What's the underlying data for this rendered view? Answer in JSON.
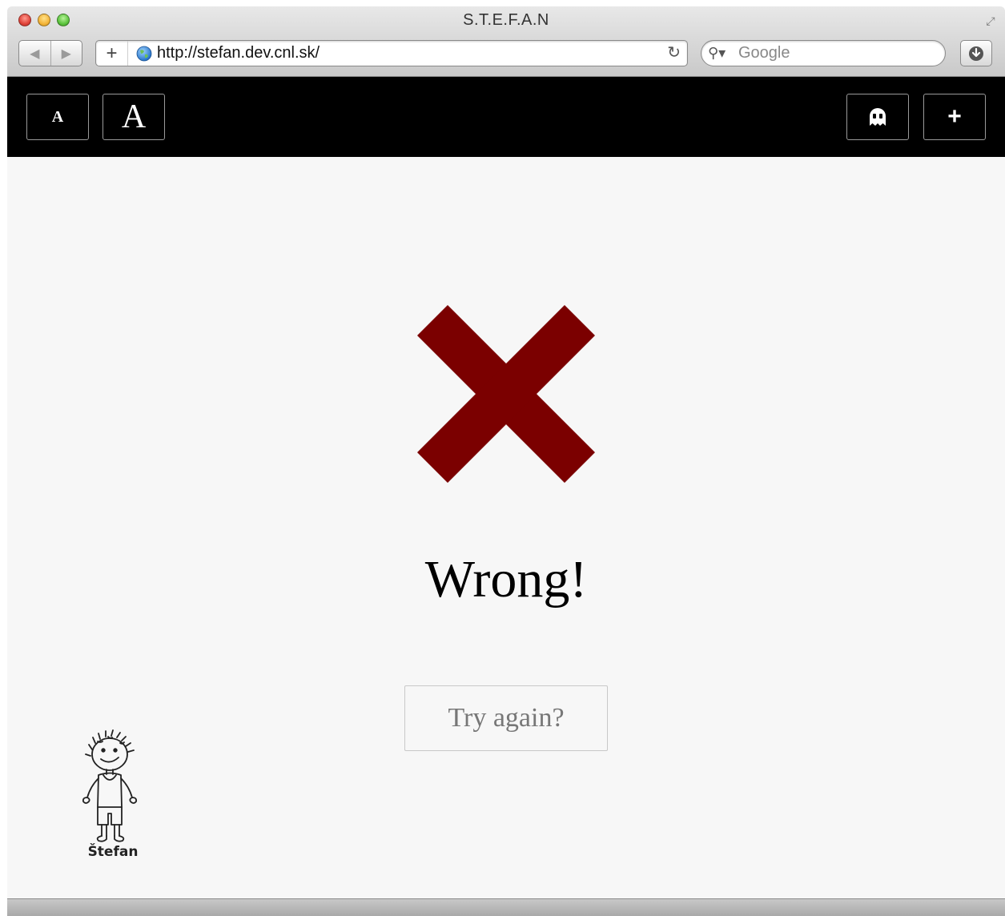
{
  "browser": {
    "window_title": "S.T.E.F.A.N",
    "url": "http://stefan.dev.cnl.sk/",
    "search_placeholder": "Google",
    "back_icon": "back-arrow-icon",
    "forward_icon": "forward-arrow-icon",
    "add_bookmark_label": "+",
    "reload_icon": "reload-icon",
    "download_icon": "download-icon"
  },
  "toolbar": {
    "font_smaller_label": "A",
    "font_larger_label": "A",
    "ghost_icon": "ghost-icon",
    "add_label": "+"
  },
  "main": {
    "status_icon": "cross-icon",
    "accent_color": "#7b0000",
    "result_text": "Wrong!",
    "try_again_label": "Try again?"
  },
  "mascot": {
    "name": "Štefan"
  }
}
